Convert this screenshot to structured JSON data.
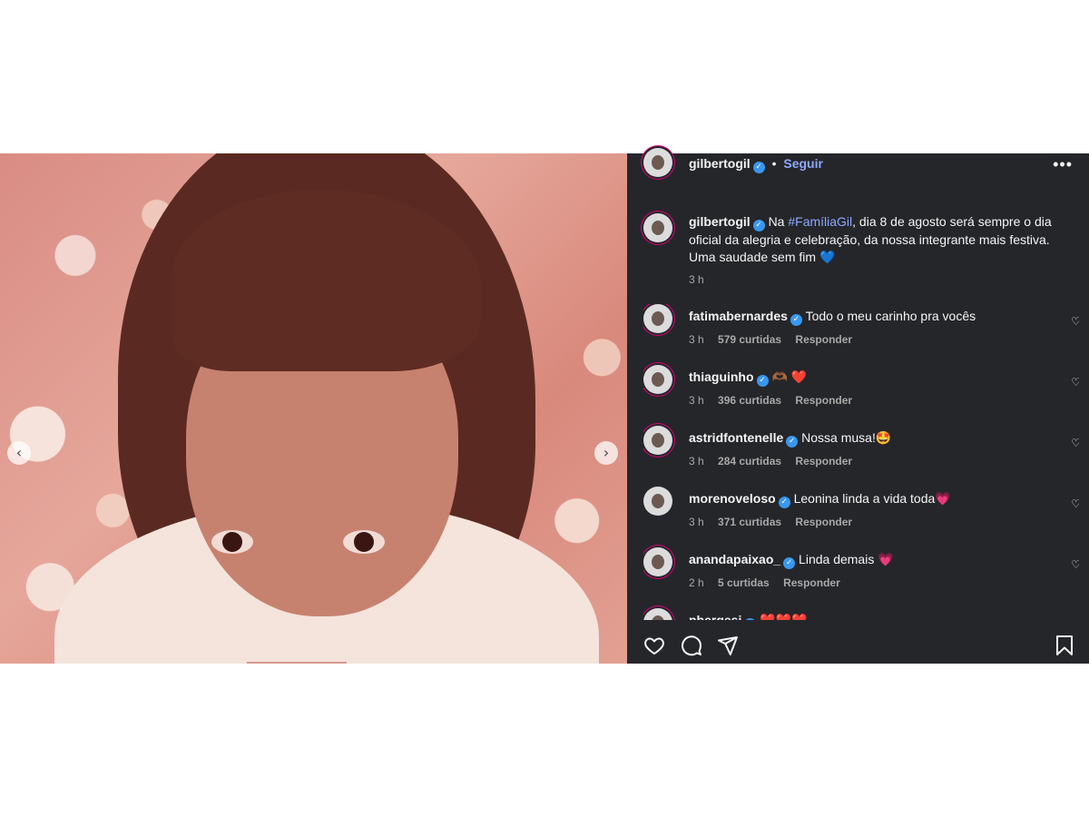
{
  "post": {
    "author": "gilbertogil",
    "follow_label": "Seguir",
    "separator": "•",
    "more_label": "•••",
    "caption": {
      "prefix": "Na ",
      "hashtag": "#FamíliaGil",
      "rest": ", dia 8 de agosto será sempre o dia oficial da alegria e celebração, da nossa integrante mais festiva. Uma saudade sem fim",
      "emoji": "💙",
      "time": "3 h"
    }
  },
  "carousel": {
    "prev": "‹",
    "next": "›"
  },
  "comments": [
    {
      "user": "fatimabernardes",
      "text": "Todo o meu carinho pra vocês",
      "time": "3 h",
      "likes": "579 curtidas",
      "reply": "Responder"
    },
    {
      "user": "thiaguinho",
      "text": "🫶🏾 ❤️",
      "time": "3 h",
      "likes": "396 curtidas",
      "reply": "Responder"
    },
    {
      "user": "astridfontenelle",
      "text": "Nossa musa!🤩",
      "time": "3 h",
      "likes": "284 curtidas",
      "reply": "Responder"
    },
    {
      "user": "morenoveloso",
      "text": "Leonina linda a vida toda💗",
      "time": "3 h",
      "likes": "371 curtidas",
      "reply": "Responder"
    },
    {
      "user": "anandapaixao_",
      "text": "Linda demais 💗",
      "time": "2 h",
      "likes": "5 curtidas",
      "reply": "Responder"
    },
    {
      "user": "pbergesi",
      "text": "❤️❤️❤️",
      "time": "",
      "likes": "",
      "reply": ""
    }
  ],
  "icons": {
    "like": "heart-icon",
    "comment": "comment-icon",
    "share": "share-icon",
    "save": "bookmark-icon"
  },
  "colors": {
    "panel_bg": "#25262a",
    "link": "#8ea9ff",
    "verified": "#3897f0"
  }
}
